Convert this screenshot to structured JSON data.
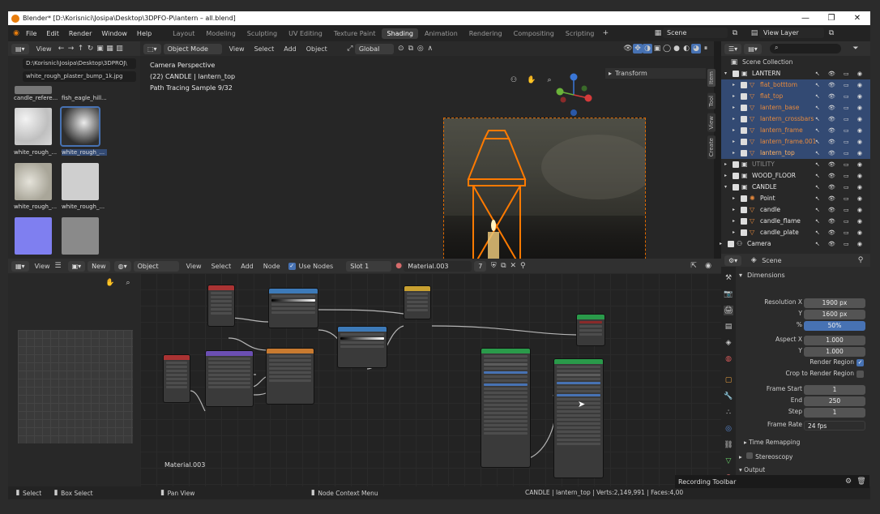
{
  "titlebar": {
    "title": "Blender* [D:\\Korisnici\\Josipa\\Desktop\\3DPFO-P\\lantern – all.blend]"
  },
  "menu": {
    "items": [
      "File",
      "Edit",
      "Render",
      "Window",
      "Help"
    ],
    "workspaces": [
      "Layout",
      "Modeling",
      "Sculpting",
      "UV Editing",
      "Texture Paint",
      "Shading",
      "Animation",
      "Rendering",
      "Compositing",
      "Scripting"
    ],
    "active_workspace": "Shading",
    "scene_label": "Scene",
    "view_layer_label": "View Layer"
  },
  "filebrowser": {
    "view_menu": "View",
    "path": "D:\\Korisnici\\Josipa\\Desktop\\3DPROJ\\",
    "file": "white_rough_plaster_bump_1k.jpg",
    "thumbs": [
      {
        "label": "candle_refere..."
      },
      {
        "label": "fish_eagle_hill..."
      },
      {
        "label": "white_rough_..."
      },
      {
        "label": "white_rough_..."
      },
      {
        "label": "white_rough_..."
      },
      {
        "label": "white_rough_..."
      },
      {
        "label": ""
      },
      {
        "label": ""
      }
    ]
  },
  "viewport": {
    "mode": "Object Mode",
    "menus": [
      "View",
      "Select",
      "Add",
      "Object"
    ],
    "orientation": "Global",
    "overlay_lines": [
      "Camera Perspective",
      "(22) CANDLE | lantern_top",
      "Path Tracing Sample 9/32"
    ],
    "sidebar_panel": "Transform",
    "side_tabs": [
      "Item",
      "Tool",
      "View",
      "Create"
    ]
  },
  "outliner": {
    "root": "Scene Collection",
    "rows": [
      {
        "name": "LANTERN",
        "selected": false,
        "color": "#e6e6e6"
      },
      {
        "name": "flat_botttom",
        "selected": true,
        "color": "#e88a3c"
      },
      {
        "name": "flat_top",
        "selected": true,
        "color": "#e88a3c"
      },
      {
        "name": "lantern_base",
        "selected": true,
        "color": "#e88a3c"
      },
      {
        "name": "lantern_crossbars",
        "selected": true,
        "color": "#e88a3c"
      },
      {
        "name": "lantern_frame",
        "selected": true,
        "color": "#e88a3c"
      },
      {
        "name": "lantern_frame.001",
        "selected": true,
        "color": "#e88a3c"
      },
      {
        "name": "lantern_top",
        "selected": true,
        "color": "#ffb060"
      },
      {
        "name": "UTILITY",
        "selected": false,
        "color": "#8a8a8a"
      },
      {
        "name": "WOOD_FLOOR",
        "selected": false,
        "color": "#e6e6e6"
      },
      {
        "name": "CANDLE",
        "selected": false,
        "color": "#e6e6e6"
      },
      {
        "name": "Point",
        "selected": false,
        "color": "#e6e6e6"
      },
      {
        "name": "candle",
        "selected": false,
        "color": "#e6e6e6"
      },
      {
        "name": "candle_flame",
        "selected": false,
        "color": "#e6e6e6"
      },
      {
        "name": "candle_plate",
        "selected": false,
        "color": "#e6e6e6"
      },
      {
        "name": "Camera",
        "selected": false,
        "color": "#e6e6e6"
      }
    ]
  },
  "props": {
    "scene": "Scene",
    "section": "Dimensions",
    "fields": [
      {
        "label": "Resolution X",
        "value": "1900 px"
      },
      {
        "label": "Y",
        "value": "1600 px"
      },
      {
        "label": "%",
        "value": "50%"
      },
      {
        "label": "Aspect X",
        "value": "1.000"
      },
      {
        "label": "Y",
        "value": "1.000"
      }
    ],
    "render_region": "Render Region",
    "crop": "Crop to Render Region",
    "frames": [
      {
        "label": "Frame Start",
        "value": "1"
      },
      {
        "label": "End",
        "value": "250"
      },
      {
        "label": "Step",
        "value": "1"
      }
    ],
    "frame_rate_label": "Frame Rate",
    "frame_rate": "24 fps",
    "subpanels": [
      "Time Remapping",
      "Stereoscopy",
      "Output"
    ]
  },
  "nodeeditor": {
    "left_menus": [
      "View",
      "New"
    ],
    "object": "Object",
    "menus": [
      "View",
      "Select",
      "Add",
      "Node"
    ],
    "use_nodes": "Use Nodes",
    "slot": "Slot 1",
    "material": "Material.003",
    "users": "7",
    "material_label": "Material.003"
  },
  "status": {
    "select": "Select",
    "box_select": "Box Select",
    "pan_view": "Pan View",
    "context_menu": "Node Context Menu",
    "info": "CANDLE | lantern_top | Verts:2,149,991 | Faces:4,00"
  },
  "recording": {
    "label": "Recording Toolbar"
  }
}
